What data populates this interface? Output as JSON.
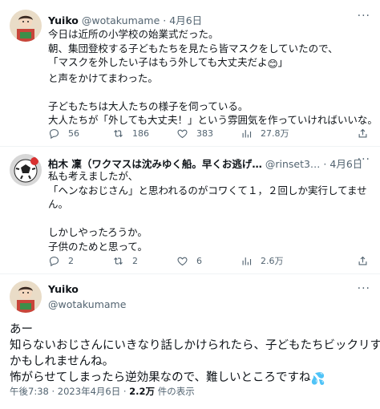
{
  "tweets": [
    {
      "name": "Yuiko",
      "handle": "@wotakumame",
      "date": "4月6日",
      "lines": [
        "今日は近所の小学校の始業式だった。",
        "朝、集団登校する子どもたちを見たら皆マスクをしていたので、",
        "「マスクを外したい子はもう外しても大丈夫だよ",
        "と声をかけてまわった。",
        "",
        "子どもたちは大人たちの様子を伺っている。",
        "大人たちが「外しても大丈夫！」という雰囲気を作っていければいいな。"
      ],
      "emoji_after_line3": "😊",
      "line3_tail": "」",
      "replies": "56",
      "retweets": "186",
      "likes": "383",
      "views": "27.8万"
    },
    {
      "name": "柏木 凜（ワクマスは沈みゆく船。早くお逃げ…",
      "handle": "@rinset3…",
      "date": "4月6日",
      "lines": [
        "私も考えましたが、",
        "「ヘンなおじさん」と思われるのがコワくて１，２回しか実行してませ",
        "ん。",
        "",
        "しかしやったろうか。",
        "子供のためと思って。"
      ],
      "replies": "2",
      "retweets": "2",
      "likes": "6",
      "views": "2.6万"
    }
  ],
  "main": {
    "name": "Yuiko",
    "handle": "@wotakumame",
    "lines": [
      "あー",
      "知らないおじさんにいきなり話しかけられたら、子どもたちビックリする",
      "かもしれませんね。",
      "怖がらせてしまったら逆効果なので、難しいところですね"
    ],
    "emoji": "💦",
    "time": "午後7:38",
    "date": "2023年4月6日",
    "views": "2.2万",
    "views_label": "件の表示",
    "separator": "·"
  },
  "icons": [
    "reply-icon",
    "retweet-icon",
    "like-icon",
    "views-icon",
    "share-icon",
    "more-icon"
  ],
  "colors": {
    "text": "#0f1419",
    "secondary": "#536471",
    "divider": "#eff3f4",
    "accent": "#1d9bf0"
  }
}
